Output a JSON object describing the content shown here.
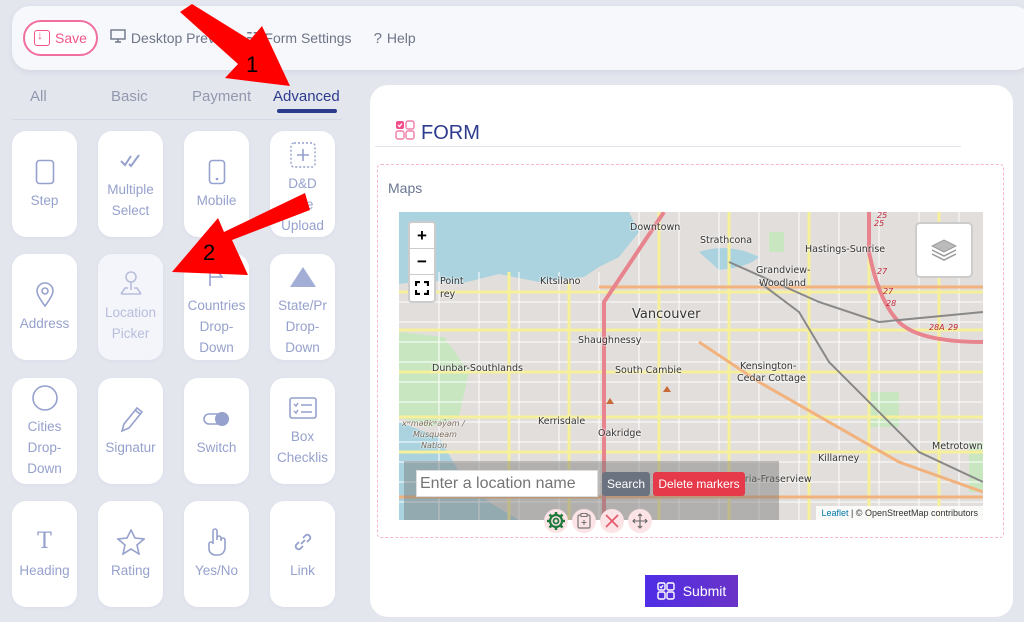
{
  "toolbar": {
    "save_label": "Save",
    "items": [
      {
        "icon": "monitor-icon",
        "label": "Desktop Preview"
      },
      {
        "icon": "settings-icon",
        "label": "Form Settings"
      },
      {
        "icon": "help-icon",
        "label": "Help"
      }
    ]
  },
  "palette": {
    "tabs": [
      {
        "label": "All",
        "active": false
      },
      {
        "label": "Basic",
        "active": false
      },
      {
        "label": "Payment",
        "active": false
      },
      {
        "label": "Advanced",
        "active": true
      }
    ],
    "tiles": [
      {
        "label": "Step",
        "icon": "tablet-icon"
      },
      {
        "label": "Multiple Select",
        "icon": "double-check-icon"
      },
      {
        "label": "Mobile",
        "icon": "mobile-icon"
      },
      {
        "label": "D&D File Upload",
        "icon": "upload-box-icon"
      },
      {
        "label": "Address",
        "icon": "map-pin-icon"
      },
      {
        "label": "Location Picker",
        "icon": "location-picker-icon",
        "disabled": true
      },
      {
        "label": "Countries Drop-Down",
        "icon": "flag-icon"
      },
      {
        "label": "State/Province Drop-Down",
        "icon": "triangle-icon"
      },
      {
        "label": "Cities Drop-Down",
        "icon": "circle-icon"
      },
      {
        "label": "Signature",
        "icon": "pen-icon"
      },
      {
        "label": "Switch",
        "icon": "toggle-icon"
      },
      {
        "label": "Box Checklist",
        "icon": "checklist-icon"
      },
      {
        "label": "Heading",
        "icon": "heading-icon"
      },
      {
        "label": "Rating",
        "icon": "star-icon"
      },
      {
        "label": "Yes/No",
        "icon": "hand-pointer-icon"
      },
      {
        "label": "Link",
        "icon": "link-icon"
      }
    ]
  },
  "form": {
    "title": "FORM",
    "field_label": "Maps",
    "map": {
      "zoom_in": "+",
      "zoom_out": "−",
      "places": [
        "Downtown",
        "Strathcona",
        "Hastings-Sunrise",
        "Grandview-",
        "Woodland",
        "Kitsilano",
        "Point",
        "rey",
        "Vancouver",
        "Shaughnessy",
        "Dunbar-Southlands",
        "South Cambie",
        "Kensington-",
        "Cedar Cottage",
        "Kerrisdale",
        "Oakridge",
        "Killarney",
        "Metrotown",
        "oria-Fraserview",
        "xʷməθkʷəy̓əm /",
        "Musqueam",
        "Nation"
      ],
      "route_labels": [
        "25",
        "25",
        "27",
        "27",
        "28",
        "28A",
        "29"
      ],
      "search_placeholder": "Enter a location name",
      "search_label": "Search",
      "delete_label": "Delete markers",
      "attribution_link": "Leaflet",
      "attribution_text": " | © OpenStreetMap contributors"
    },
    "field_tools": [
      "settings-icon",
      "clipboard-add-icon",
      "close-icon",
      "move-icon"
    ],
    "submit_label": "Submit"
  },
  "annotations": [
    {
      "number": "1",
      "color": "#ff0000"
    },
    {
      "number": "2",
      "color": "#ff0000"
    }
  ]
}
